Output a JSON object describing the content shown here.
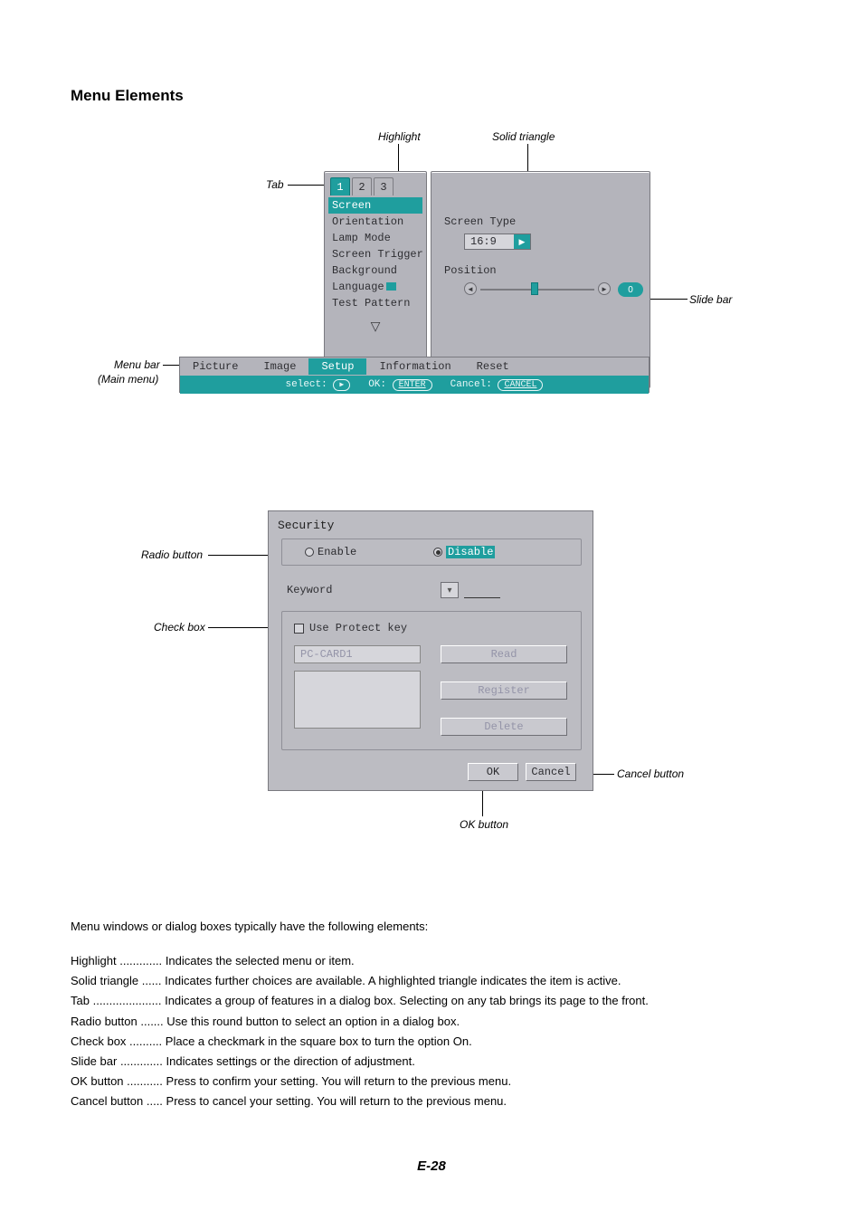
{
  "title": "Menu Elements",
  "callouts": {
    "tab": "Tab",
    "highlight": "Highlight",
    "solid_triangle": "Solid triangle",
    "slide_bar": "Slide bar",
    "menu_bar": "Menu bar",
    "main_menu": "(Main menu)",
    "radio_button": "Radio button",
    "check_box": "Check box",
    "cancel_button": "Cancel button",
    "ok_button": "OK button"
  },
  "panelA": {
    "tabs": [
      "1",
      "2",
      "3"
    ],
    "items": [
      "Screen",
      "Orientation",
      "Lamp Mode",
      "Screen Trigger",
      "Background",
      "Language",
      "Test Pattern"
    ]
  },
  "panelB": {
    "screen_type_label": "Screen Type",
    "screen_type_value": "16:9",
    "position_label": "Position"
  },
  "menubar": {
    "items": [
      "Picture",
      "Image",
      "Setup",
      "Information",
      "Reset"
    ],
    "help_select": "select:",
    "help_ok": "OK:",
    "help_ok_btn": "ENTER",
    "help_cancel": "Cancel:",
    "help_cancel_btn": "CANCEL"
  },
  "dialog": {
    "title": "Security",
    "enable": "Enable",
    "disable": "Disable",
    "keyword": "Keyword",
    "use_protect": "Use Protect key",
    "card": "PC-CARD1",
    "read": "Read",
    "register": "Register",
    "delete": "Delete",
    "ok": "OK",
    "cancel": "Cancel"
  },
  "defs": {
    "intro": "Menu windows or dialog boxes typically have the following elements:",
    "rows": [
      {
        "term": "Highlight",
        "dots": ".............",
        "desc": "Indicates the selected menu or item."
      },
      {
        "term": "Solid triangle",
        "dots": "......",
        "desc": "Indicates further choices are available. A highlighted triangle indicates the item is active."
      },
      {
        "term": "Tab",
        "dots": ".....................",
        "desc": "Indicates a group of features in a dialog box. Selecting on any tab brings its page to the front."
      },
      {
        "term": "Radio button",
        "dots": ".......",
        "desc": "Use this round button to select an option in a dialog box."
      },
      {
        "term": "Check box",
        "dots": "..........",
        "desc": "Place a checkmark in the square box to turn the option On."
      },
      {
        "term": "Slide bar",
        "dots": ".............",
        "desc": "Indicates settings or the direction of adjustment."
      },
      {
        "term": "OK button",
        "dots": "...........",
        "desc": "Press to confirm your setting. You will return to the previous menu."
      },
      {
        "term": "Cancel button",
        "dots": ".....",
        "desc": "Press to cancel your setting. You will return to the previous menu."
      }
    ]
  },
  "page_number": "E-28"
}
